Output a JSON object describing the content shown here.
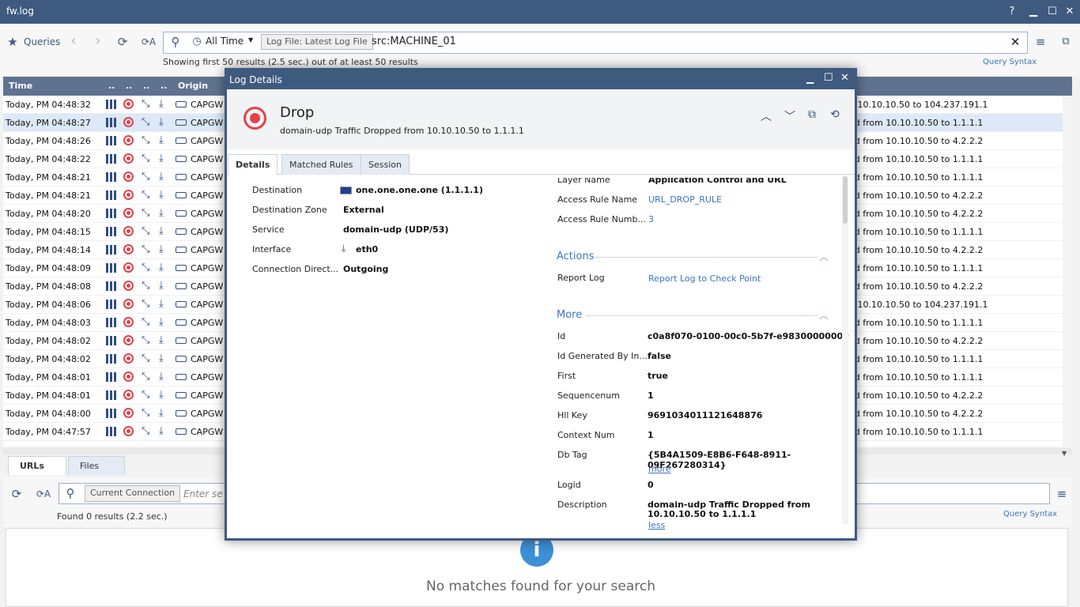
{
  "window": {
    "title": "fw.log"
  },
  "toolbar": {
    "queries_label": "Queries",
    "time_range": "All Time",
    "chip": "Log File: Latest Log File",
    "query": "src:MACHINE_01",
    "results_summary": "Showing first 50 results (2.5 sec.) out of at least 50 results",
    "query_syntax": "Query Syntax"
  },
  "table": {
    "headers": {
      "time": "Time",
      "c1": "..",
      "c2": "..",
      "c3": "..",
      "c4": "..",
      "origin": "Origin"
    },
    "rows": [
      {
        "time": "Today, PM 04:48:32",
        "origin": "CAPGW",
        "desc": "n 10.10.10.50 to 104.237.191.1"
      },
      {
        "time": "Today, PM 04:48:27",
        "origin": "CAPGW",
        "desc": "ed from 10.10.10.50 to 1.1.1.1"
      },
      {
        "time": "Today, PM 04:48:26",
        "origin": "CAPGW",
        "desc": "ed from 10.10.10.50 to 4.2.2.2"
      },
      {
        "time": "Today, PM 04:48:22",
        "origin": "CAPGW",
        "desc": "ed from 10.10.10.50 to 1.1.1.1"
      },
      {
        "time": "Today, PM 04:48:21",
        "origin": "CAPGW",
        "desc": "ed from 10.10.10.50 to 1.1.1.1"
      },
      {
        "time": "Today, PM 04:48:21",
        "origin": "CAPGW",
        "desc": "ed from 10.10.10.50 to 4.2.2.2"
      },
      {
        "time": "Today, PM 04:48:20",
        "origin": "CAPGW",
        "desc": "ed from 10.10.10.50 to 4.2.2.2"
      },
      {
        "time": "Today, PM 04:48:15",
        "origin": "CAPGW",
        "desc": "ed from 10.10.10.50 to 1.1.1.1"
      },
      {
        "time": "Today, PM 04:48:14",
        "origin": "CAPGW",
        "desc": "ed from 10.10.10.50 to 4.2.2.2"
      },
      {
        "time": "Today, PM 04:48:09",
        "origin": "CAPGW",
        "desc": "ed from 10.10.10.50 to 1.1.1.1"
      },
      {
        "time": "Today, PM 04:48:08",
        "origin": "CAPGW",
        "desc": "ed from 10.10.10.50 to 4.2.2.2"
      },
      {
        "time": "Today, PM 04:48:06",
        "origin": "CAPGW",
        "desc": "n 10.10.10.50 to 104.237.191.1"
      },
      {
        "time": "Today, PM 04:48:03",
        "origin": "CAPGW",
        "desc": "ed from 10.10.10.50 to 1.1.1.1"
      },
      {
        "time": "Today, PM 04:48:02",
        "origin": "CAPGW",
        "desc": "ed from 10.10.10.50 to 4.2.2.2"
      },
      {
        "time": "Today, PM 04:48:02",
        "origin": "CAPGW",
        "desc": "ed from 10.10.10.50 to 1.1.1.1"
      },
      {
        "time": "Today, PM 04:48:01",
        "origin": "CAPGW",
        "desc": "ed from 10.10.10.50 to 1.1.1.1"
      },
      {
        "time": "Today, PM 04:48:01",
        "origin": "CAPGW",
        "desc": "ed from 10.10.10.50 to 4.2.2.2"
      },
      {
        "time": "Today, PM 04:48:00",
        "origin": "CAPGW",
        "desc": "ed from 10.10.10.50 to 4.2.2.2"
      },
      {
        "time": "Today, PM 04:47:57",
        "origin": "CAPGW",
        "desc": "ed from 10.10.10.50 to 1.1.1.1"
      }
    ]
  },
  "bottom": {
    "tabs": [
      "URLs",
      "Files"
    ],
    "chip": "Current Connection",
    "search_placeholder": "Enter se",
    "found": "Found 0 results (2.2 sec.)",
    "query_syntax": "Query Syntax",
    "empty_message": "No matches found for your search"
  },
  "dialog": {
    "title": "Log Details",
    "action": "Drop",
    "subtitle": "domain-udp Traffic Dropped from 10.10.10.50 to 1.1.1.1",
    "tabs": [
      "Details",
      "Matched Rules",
      "Session"
    ],
    "left_fields": [
      {
        "label": "Destination",
        "value": "one.one.one.one (1.1.1.1)"
      },
      {
        "label": "Destination Zone",
        "value": "External"
      },
      {
        "label": "Service",
        "value": "domain-udp (UDP/53)"
      },
      {
        "label": "Interface",
        "value": "eth0"
      },
      {
        "label": "Connection Direct...",
        "value": "Outgoing"
      }
    ],
    "right_top": [
      {
        "label": "Layer Name",
        "value": "Application Control and URL"
      },
      {
        "label": "Access Rule Name",
        "value": "URL_DROP_RULE"
      },
      {
        "label": "Access Rule Numb...",
        "value": "3"
      }
    ],
    "actions_title": "Actions",
    "actions": [
      {
        "label": "Report Log",
        "value": "Report Log to Check Point"
      }
    ],
    "more_title": "More",
    "more": [
      {
        "label": "Id",
        "value": "c0a8f070-0100-00c0-5b7f-e98300000000"
      },
      {
        "label": "Id Generated By In...",
        "value": "false"
      },
      {
        "label": "First",
        "value": "true"
      },
      {
        "label": "Sequencenum",
        "value": "1"
      },
      {
        "label": "Hll Key",
        "value": "9691034011121648876"
      },
      {
        "label": "Context Num",
        "value": "1"
      },
      {
        "label": "Db Tag",
        "value": "{5B4A1509-E8B6-F648-8911-09F267280314}"
      },
      {
        "label": "Logid",
        "value": "0"
      },
      {
        "label": "Description",
        "value": "domain-udp Traffic Dropped from"
      }
    ],
    "db_tag_more": "more",
    "description_line2": "10.10.10.50 to 1.1.1.1",
    "description_less": "less"
  },
  "colors": {
    "accent": "#3f5a7f",
    "drop": "#e0434b",
    "link": "#3c74c0"
  }
}
